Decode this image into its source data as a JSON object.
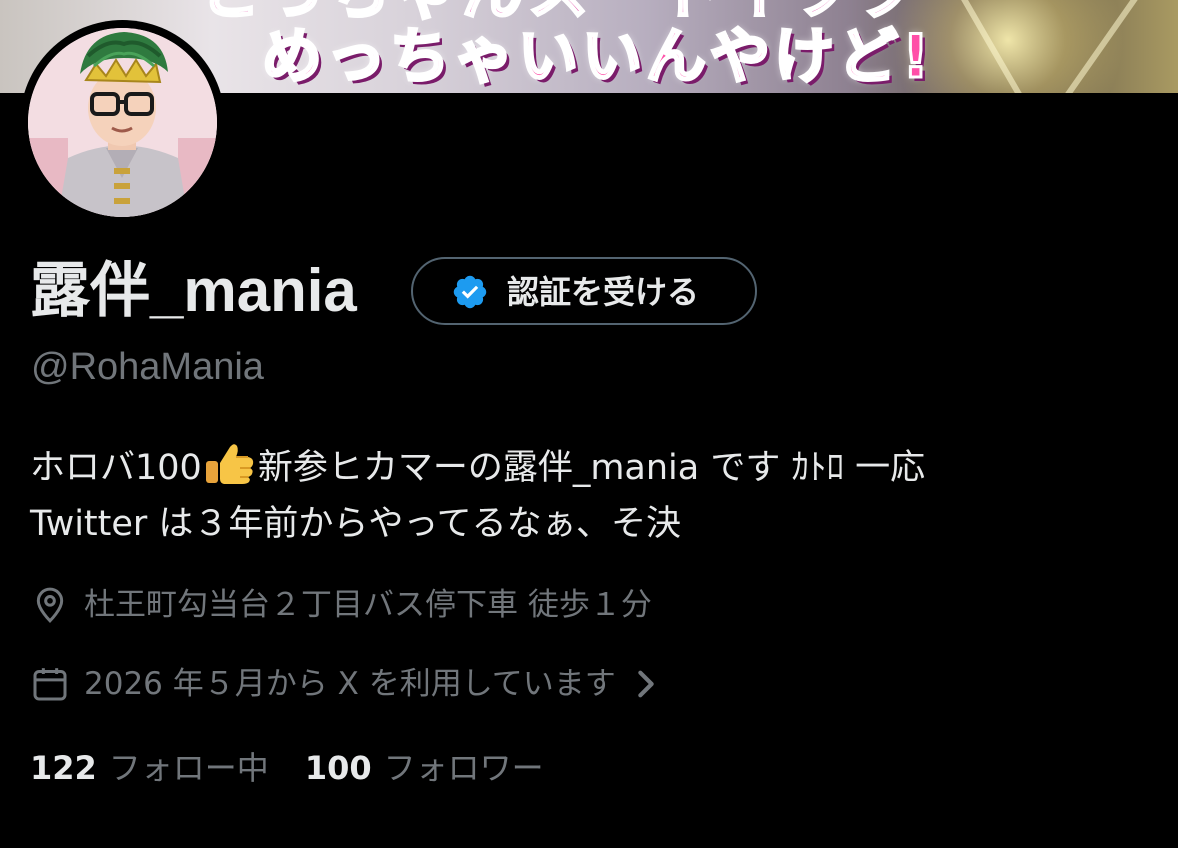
{
  "banner": {
    "top_text": "とっちゃんスートイツク",
    "main_text": "めっちゃいいんやけど!"
  },
  "profile": {
    "display_name": "露伴_mania",
    "handle": "@RohaMania",
    "verify_button_label": "認証を受ける",
    "bio_line1_before": "ホロバ100",
    "bio_line1_after": "新参ヒカマーの露伴_mania です ｶﾄﾛ 一応",
    "bio_line2": "Twitter は３年前からやってるなぁ、そ決",
    "location": "杜王町勾当台２丁目バス停下車 徒歩１分",
    "joined": "2026 年５月から X を利用しています"
  },
  "stats": {
    "following_count": "122",
    "following_label": "フォロー中",
    "followers_count": "100",
    "followers_label": "フォロワー"
  },
  "colors": {
    "background": "#000000",
    "text_primary": "#e7e9ea",
    "text_secondary": "#71767b",
    "verified_blue": "#1d9bf0",
    "button_border": "#536471"
  },
  "icons": {
    "verified": "verified-badge-icon",
    "location": "location-pin-icon",
    "calendar": "calendar-icon",
    "chevron": "chevron-right-icon",
    "emoji": "thumbs-up-emoji"
  }
}
